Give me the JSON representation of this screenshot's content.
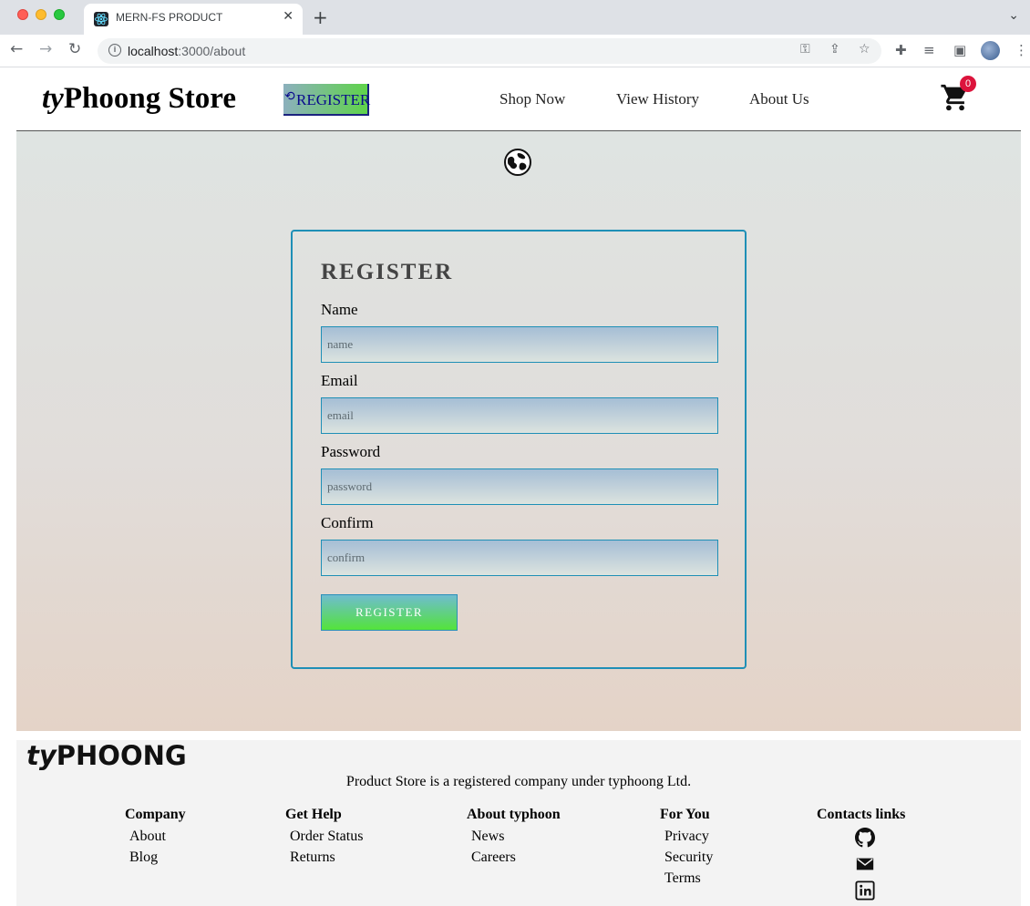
{
  "browser": {
    "tab_title": "MERN-FS PRODUCT",
    "url_host": "localhost",
    "url_path": ":3000/about"
  },
  "header": {
    "brand_italic": "ty",
    "brand_rest": "Phoong Store",
    "register_label": "REGISTER",
    "nav": [
      "Shop Now",
      "View History",
      "About Us"
    ],
    "cart_count": "0"
  },
  "form": {
    "title": "REGISTER",
    "fields": [
      {
        "label": "Name",
        "placeholder": "name"
      },
      {
        "label": "Email",
        "placeholder": "email"
      },
      {
        "label": "Password",
        "placeholder": "password"
      },
      {
        "label": "Confirm",
        "placeholder": "confirm"
      }
    ],
    "submit_label": "REGISTER"
  },
  "footer": {
    "brand_italic": "ty",
    "brand_rest": "PHOONG",
    "tagline": "Product Store is a registered company under typhoong Ltd.",
    "columns": [
      {
        "heading": "Company",
        "links": [
          "About",
          "Blog"
        ]
      },
      {
        "heading": "Get Help",
        "links": [
          "Order Status",
          "Returns"
        ]
      },
      {
        "heading": "About typhoon",
        "links": [
          "News",
          "Careers"
        ]
      },
      {
        "heading": "For You",
        "links": [
          "Privacy",
          "Security",
          "Terms"
        ]
      }
    ],
    "contacts_heading": "Contacts links",
    "contact_icons": [
      "github-icon",
      "mail-icon",
      "linkedin-icon"
    ]
  },
  "colors": {
    "card_border": "#1e8fb6",
    "badge": "#dc143c",
    "button_green": "#54e33a"
  }
}
